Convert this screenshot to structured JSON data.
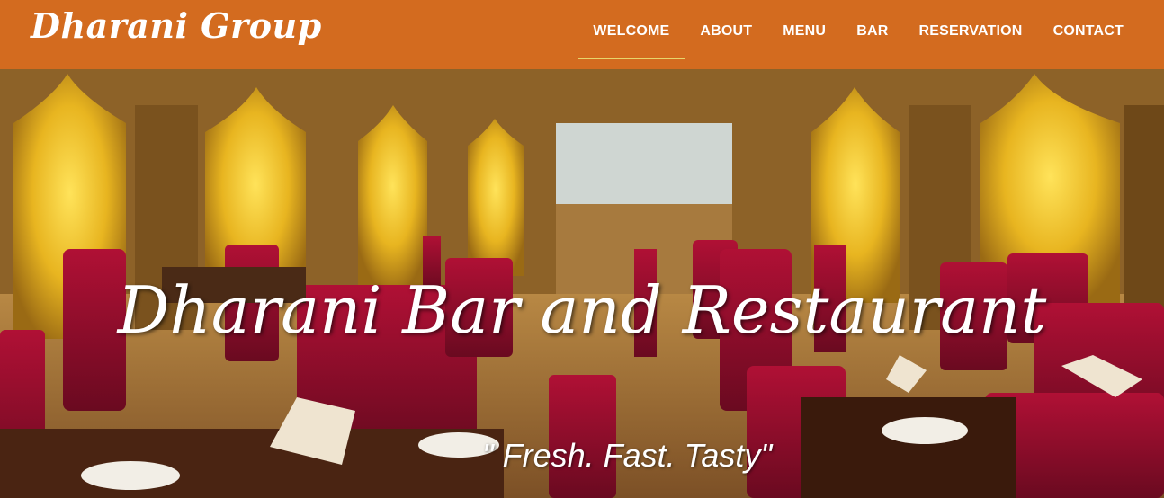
{
  "brand": {
    "name": "Dharani Group"
  },
  "nav": {
    "items": [
      {
        "label": "WELCOME",
        "active": true
      },
      {
        "label": "ABOUT",
        "active": false
      },
      {
        "label": "MENU",
        "active": false
      },
      {
        "label": "BAR",
        "active": false
      },
      {
        "label": "RESERVATION",
        "active": false
      },
      {
        "label": "CONTACT",
        "active": false
      }
    ]
  },
  "hero": {
    "title": "Dharani Bar and Restaurant",
    "tagline": "\" Fresh. Fast. Tasty\""
  },
  "colors": {
    "navbar": "#d36b1f",
    "text": "#ffffff",
    "active_underline": "#e7d66b"
  }
}
